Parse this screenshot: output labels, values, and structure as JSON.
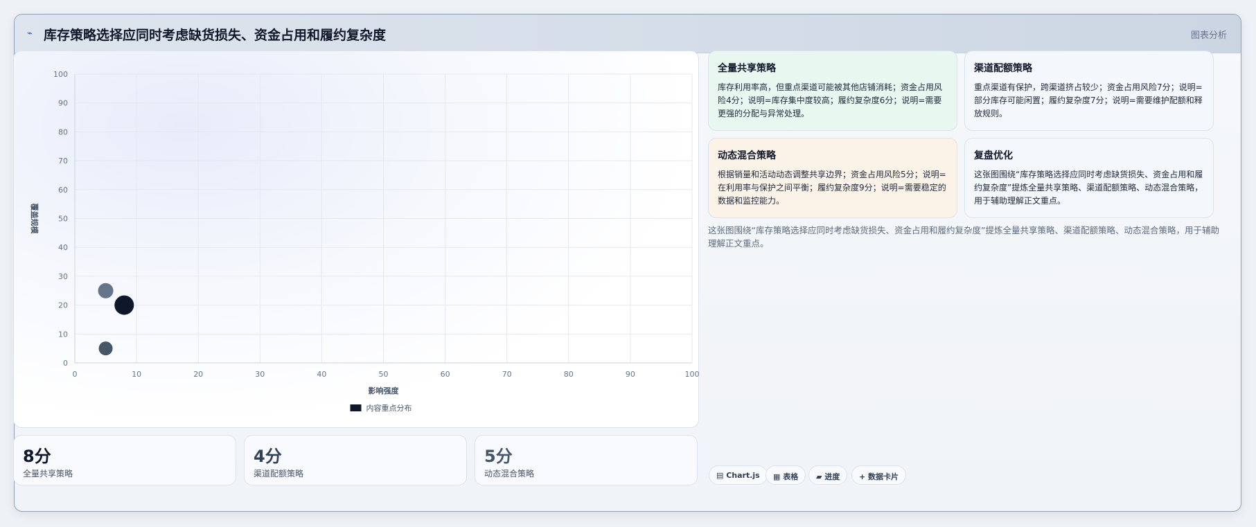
{
  "header": {
    "title": "库存策略选择应同时考虑缺货损失、资金占用和履约复杂度",
    "tag": "图表分析"
  },
  "chart_data": {
    "type": "scatter",
    "xlabel": "影响强度",
    "ylabel": "覆盖规模",
    "xlim": [
      0,
      100
    ],
    "ylim": [
      0,
      100
    ],
    "xticks": [
      "0",
      "10",
      "20",
      "30",
      "40",
      "50",
      "60",
      "70",
      "80",
      "90",
      "100"
    ],
    "yticks": [
      "0",
      "10",
      "20",
      "30",
      "40",
      "50",
      "60",
      "70",
      "80",
      "90",
      "100"
    ],
    "grid": true,
    "legend_position": "bottom",
    "series": [
      {
        "name": "内容重点分布",
        "color": "#0f172a",
        "points": [
          {
            "x": 5,
            "y": 25,
            "size": 9,
            "color": "#64748b"
          },
          {
            "x": 8,
            "y": 20,
            "size": 12,
            "color": "#0f172a"
          },
          {
            "x": 5,
            "y": 5,
            "size": 8,
            "color": "#475569"
          }
        ]
      }
    ]
  },
  "stats": [
    {
      "value": "8分",
      "label": "全量共享策略",
      "color": "#0f172a"
    },
    {
      "value": "4分",
      "label": "渠道配额策略",
      "color": "#334155"
    },
    {
      "value": "5分",
      "label": "动态混合策略",
      "color": "#475569"
    }
  ],
  "cards": [
    {
      "title": "全量共享策略",
      "body": "库存利用率高，但重点渠道可能被其他店铺消耗；资金占用风险4分；说明=库存集中度较高；履约复杂度6分；说明=需要更强的分配与异常处理。",
      "bg": "#e8f8f1"
    },
    {
      "title": "渠道配额策略",
      "body": "重点渠道有保护，跨渠道挤占较少；资金占用风险7分；说明=部分库存可能闲置；履约复杂度7分；说明=需要维护配额和释放规则。",
      "bg": "#f4f7fb"
    },
    {
      "title": "动态混合策略",
      "body": "根据销量和活动动态调整共享边界；资金占用风险5分；说明=在利用率与保护之间平衡；履约复杂度9分；说明=需要稳定的数据和监控能力。",
      "bg": "#fcf3e8"
    },
    {
      "title": "复盘优化",
      "body": "这张图围绕“库存策略选择应同时考虑缺货损失、资金占用和履约复杂度”提炼全量共享策略、渠道配额策略、动态混合策略，用于辅助理解正文重点。",
      "bg": "#f4f7fb"
    }
  ],
  "summary": "这张图围绕“库存策略选择应同时考虑缺货损失、资金占用和履约复杂度”提炼全量共享策略、渠道配额策略、动态混合策略，用于辅助理解正文重点。",
  "chips": [
    {
      "label": "▤ Chart.js",
      "icon": "chart-icon"
    },
    {
      "label": "▦ 表格",
      "icon": "table-icon"
    },
    {
      "label": "▰ 进度",
      "icon": "progress-icon"
    },
    {
      "label": "+ 数据卡片",
      "icon": "plus-icon"
    }
  ]
}
